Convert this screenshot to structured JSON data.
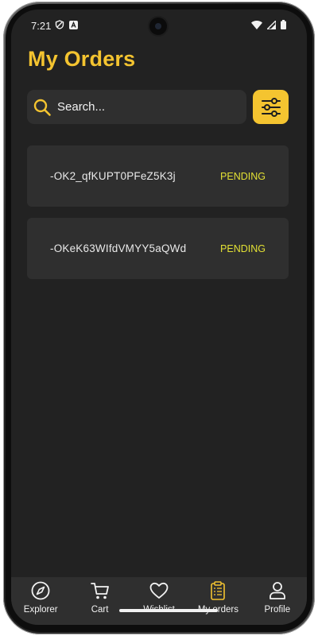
{
  "status_bar": {
    "time": "7:21"
  },
  "page": {
    "title": "My Orders"
  },
  "search": {
    "placeholder": "Search..."
  },
  "orders": [
    {
      "id": "-OK2_qfKUPT0PFeZ5K3j",
      "status": "PENDING"
    },
    {
      "id": "-OKeK63WIfdVMYY5aQWd",
      "status": "PENDING"
    }
  ],
  "bottom_nav": {
    "items": [
      {
        "label": "Explorer",
        "icon": "compass-icon"
      },
      {
        "label": "Cart",
        "icon": "cart-icon"
      },
      {
        "label": "Wishlist",
        "icon": "heart-icon"
      },
      {
        "label": "My orders",
        "icon": "clipboard-icon",
        "active": true
      },
      {
        "label": "Profile",
        "icon": "user-icon"
      }
    ]
  },
  "colors": {
    "accent": "#f4c430",
    "background": "#222222",
    "card": "#2f2f2f",
    "status_pending": "#e2e034"
  }
}
